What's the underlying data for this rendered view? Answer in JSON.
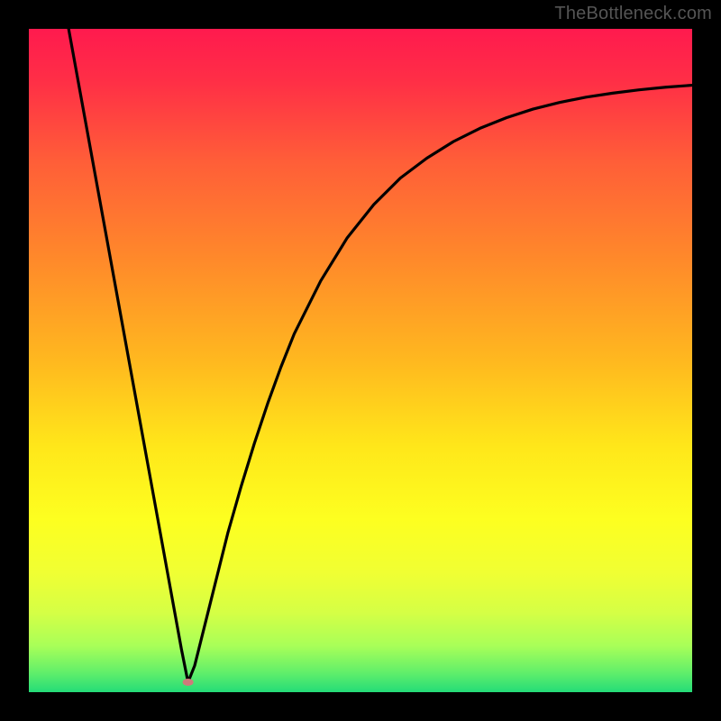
{
  "watermark": "TheBottleneck.com",
  "chart_data": {
    "type": "line",
    "title": "",
    "xlabel": "",
    "ylabel": "",
    "xlim": [
      0,
      100
    ],
    "ylim": [
      0,
      100
    ],
    "marker": {
      "x": 24,
      "y": 1.5,
      "color": "#cf7a7b",
      "rx": 6,
      "ry": 4
    },
    "gradient_stops": [
      {
        "offset": 0.0,
        "color": "#ff1a4e"
      },
      {
        "offset": 0.08,
        "color": "#ff2f46"
      },
      {
        "offset": 0.2,
        "color": "#ff5e38"
      },
      {
        "offset": 0.35,
        "color": "#ff8a2a"
      },
      {
        "offset": 0.5,
        "color": "#ffb81f"
      },
      {
        "offset": 0.63,
        "color": "#ffe71a"
      },
      {
        "offset": 0.74,
        "color": "#fdff20"
      },
      {
        "offset": 0.82,
        "color": "#f0ff33"
      },
      {
        "offset": 0.88,
        "color": "#d5ff45"
      },
      {
        "offset": 0.93,
        "color": "#a9ff58"
      },
      {
        "offset": 0.97,
        "color": "#62ef6a"
      },
      {
        "offset": 1.0,
        "color": "#24dc78"
      }
    ],
    "series": [
      {
        "name": "curve",
        "x": [
          6,
          8,
          10,
          12,
          14,
          16,
          18,
          20,
          22,
          23,
          24,
          25,
          26,
          27,
          28,
          30,
          32,
          34,
          36,
          38,
          40,
          44,
          48,
          52,
          56,
          60,
          64,
          68,
          72,
          76,
          80,
          84,
          88,
          92,
          96,
          100
        ],
        "y": [
          100,
          89,
          78,
          67,
          56,
          45,
          34,
          23,
          12,
          6.5,
          1.5,
          4,
          8,
          12,
          16,
          24,
          31,
          37.5,
          43.5,
          49,
          54,
          62,
          68.5,
          73.5,
          77.5,
          80.5,
          83,
          85,
          86.6,
          87.9,
          88.9,
          89.7,
          90.3,
          90.8,
          91.2,
          91.5
        ]
      }
    ]
  }
}
